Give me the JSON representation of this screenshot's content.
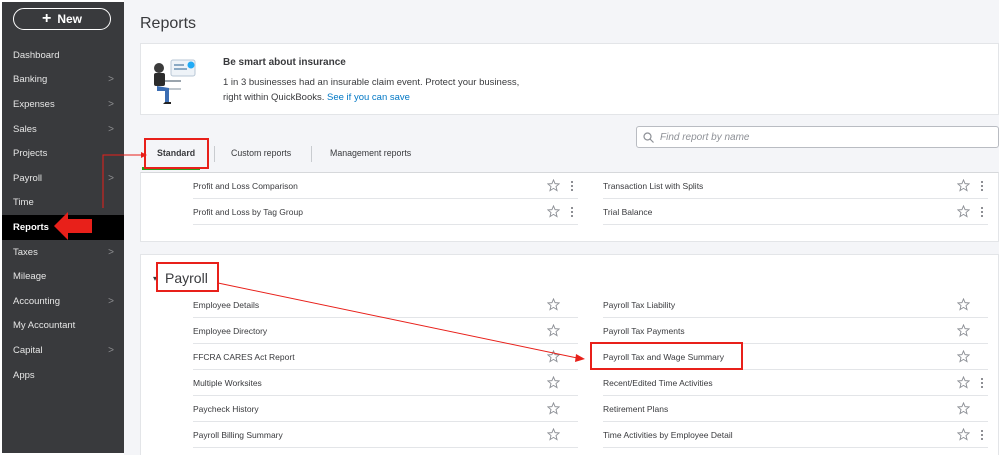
{
  "sidebar": {
    "new_label": "New",
    "items": [
      {
        "label": "Dashboard",
        "chevron": false
      },
      {
        "label": "Banking",
        "chevron": true
      },
      {
        "label": "Expenses",
        "chevron": true
      },
      {
        "label": "Sales",
        "chevron": true
      },
      {
        "label": "Projects",
        "chevron": false
      },
      {
        "label": "Payroll",
        "chevron": true
      },
      {
        "label": "Time",
        "chevron": false
      },
      {
        "label": "Reports",
        "chevron": false,
        "active": true
      },
      {
        "label": "Taxes",
        "chevron": true
      },
      {
        "label": "Mileage",
        "chevron": false
      },
      {
        "label": "Accounting",
        "chevron": true
      },
      {
        "label": "My Accountant",
        "chevron": false
      },
      {
        "label": "Capital",
        "chevron": true
      },
      {
        "label": "Apps",
        "chevron": false
      }
    ],
    "chevron_glyph": ">"
  },
  "page": {
    "title": "Reports"
  },
  "banner": {
    "title": "Be smart about insurance",
    "line1": "1 in 3 businesses had an insurable claim event. Protect your business,",
    "line2_prefix": "right within QuickBooks.",
    "link": "See if you can save"
  },
  "search": {
    "placeholder": "Find report by name"
  },
  "tabs": [
    {
      "label": "Standard",
      "active": true
    },
    {
      "label": "Custom reports"
    },
    {
      "label": "Management reports"
    }
  ],
  "top_section": {
    "left": [
      {
        "label": "Profit and Loss Comparison",
        "more": true
      },
      {
        "label": "Profit and Loss by Tag Group",
        "more": true
      }
    ],
    "right": [
      {
        "label": "Transaction List with Splits",
        "more": true
      },
      {
        "label": "Trial Balance",
        "more": true
      }
    ]
  },
  "payroll_section": {
    "title": "Payroll",
    "caret": "▾",
    "left": [
      {
        "label": "Employee Details",
        "more": false
      },
      {
        "label": "Employee Directory",
        "more": false
      },
      {
        "label": "FFCRA CARES Act Report",
        "more": false
      },
      {
        "label": "Multiple Worksites",
        "more": false
      },
      {
        "label": "Paycheck History",
        "more": false
      },
      {
        "label": "Payroll Billing Summary",
        "more": false
      }
    ],
    "right": [
      {
        "label": "Payroll Tax Liability",
        "more": false
      },
      {
        "label": "Payroll Tax Payments",
        "more": false
      },
      {
        "label": "Payroll Tax and Wage Summary",
        "more": false
      },
      {
        "label": "Recent/Edited Time Activities",
        "more": true
      },
      {
        "label": "Retirement Plans",
        "more": false
      },
      {
        "label": "Time Activities by Employee Detail",
        "more": true
      }
    ]
  },
  "colors": {
    "sidebar_bg": "#393a3d",
    "active_tab_underline": "#2ca01c",
    "link": "#0077c5",
    "annotation": "#e8201a"
  },
  "icons": [
    "plus-icon",
    "chevron-right-icon",
    "search-icon",
    "star-icon",
    "more-vertical-icon",
    "caret-down-icon"
  ]
}
